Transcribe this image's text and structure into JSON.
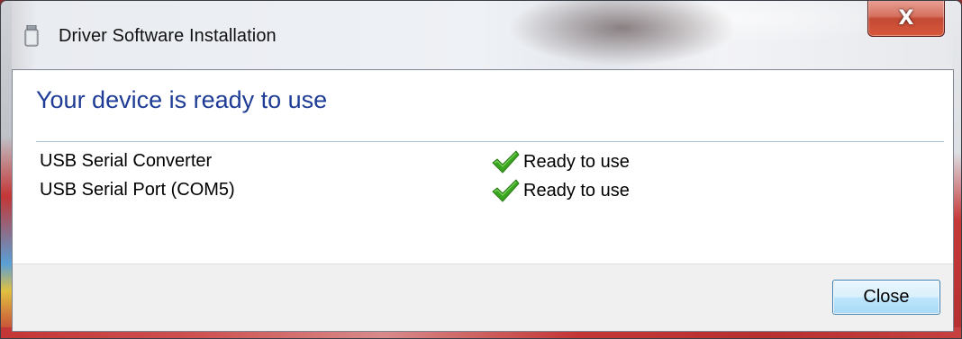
{
  "window": {
    "title": "Driver Software Installation",
    "close_glyph": "X"
  },
  "main": {
    "heading": "Your device is ready to use",
    "devices": [
      {
        "name": "USB Serial Converter",
        "status": "Ready to use",
        "status_icon": "check-icon"
      },
      {
        "name": "USB Serial Port (COM5)",
        "status": "Ready to use",
        "status_icon": "check-icon"
      }
    ]
  },
  "footer": {
    "close_label": "Close"
  },
  "colors": {
    "heading": "#1e3c96",
    "check": "#3aa520",
    "button_border": "#3c7fb1"
  }
}
